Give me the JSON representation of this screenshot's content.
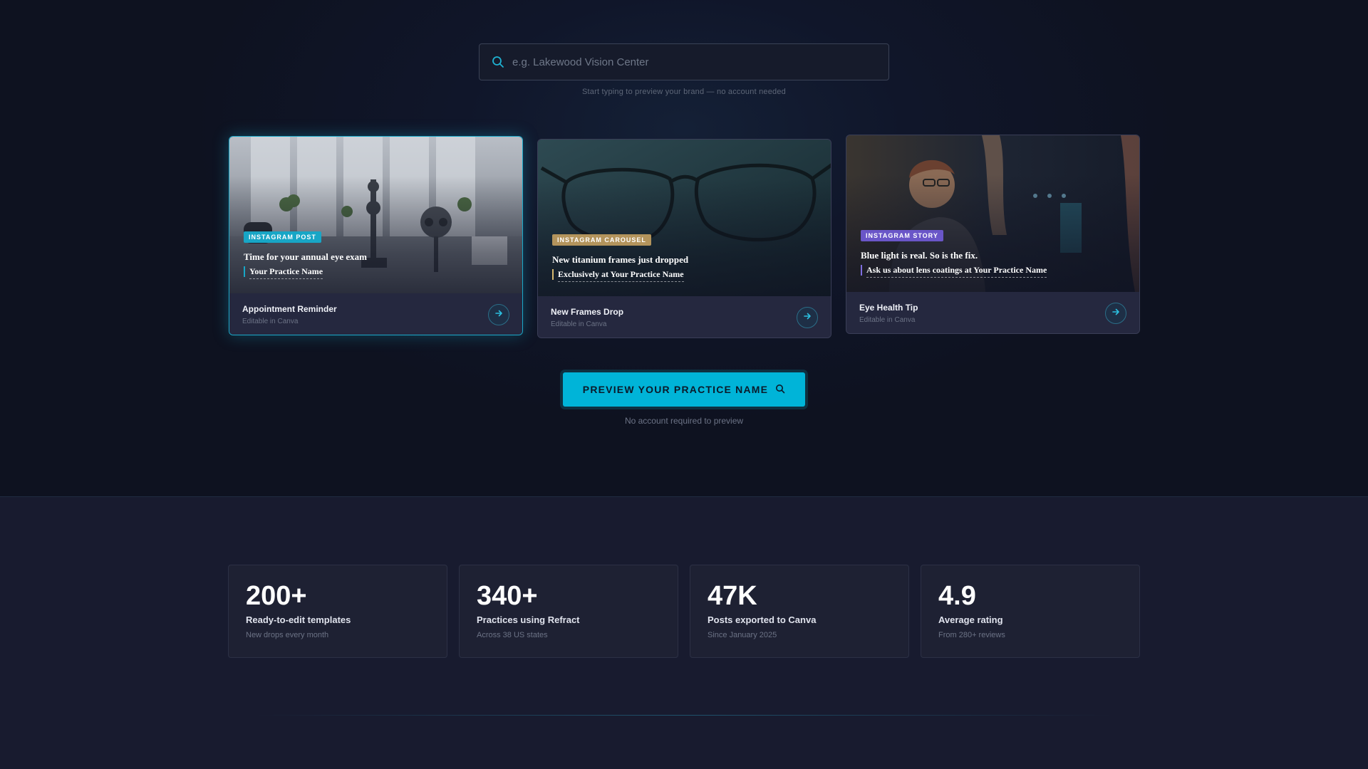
{
  "search": {
    "placeholder": "e.g. Lakewood Vision Center",
    "value": "",
    "hint": "Start typing to preview your brand — no account needed",
    "icon": "search-icon"
  },
  "cards": [
    {
      "badge": "INSTAGRAM POST",
      "badge_color": "#18a6c6",
      "headline": "Time for your annual eye exam",
      "subline": "Your Practice Name",
      "accent": "#18a6c6",
      "title": "Appointment Reminder",
      "meta": "Editable in Canva",
      "icon": "arrow-right-icon"
    },
    {
      "badge": "INSTAGRAM CAROUSEL",
      "badge_color": "#b3945c",
      "headline": "New titanium frames just dropped",
      "subline": "Exclusively at Your Practice Name",
      "accent": "#d6b86e",
      "title": "New Frames Drop",
      "meta": "Editable in Canva",
      "icon": "arrow-right-icon"
    },
    {
      "badge": "INSTAGRAM STORY",
      "badge_color": "#6a56c8",
      "headline": "Blue light is real. So is the fix.",
      "subline": "Ask us about lens coatings at Your Practice Name",
      "accent": "#7f6ee0",
      "title": "Eye Health Tip",
      "meta": "Editable in Canva",
      "icon": "arrow-right-icon"
    }
  ],
  "cta": {
    "label": "PREVIEW YOUR PRACTICE NAME",
    "note": "No account required to preview",
    "color": "#00b4d8",
    "icon": "search-icon"
  },
  "stats": [
    {
      "value": "200+",
      "label": "Ready-to-edit templates",
      "sub": "New drops every month"
    },
    {
      "value": "340+",
      "label": "Practices using Refract",
      "sub": "Across 38 US states"
    },
    {
      "value": "47K",
      "label": "Posts exported to Canva",
      "sub": "Since January 2025"
    },
    {
      "value": "4.9",
      "label": "Average rating",
      "sub": "From 280+ reviews"
    }
  ]
}
